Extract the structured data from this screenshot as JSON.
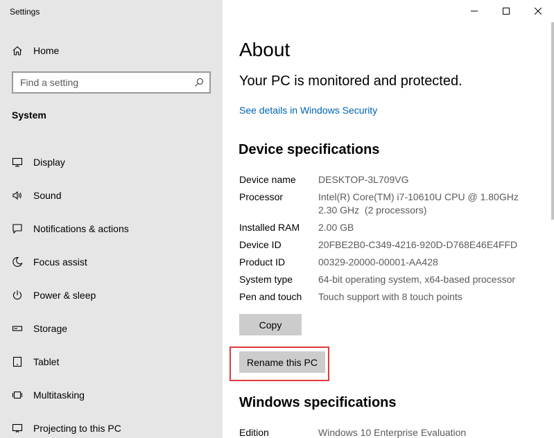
{
  "window": {
    "title": "Settings"
  },
  "sidebar": {
    "home_label": "Home",
    "search_placeholder": "Find a setting",
    "section_label": "System",
    "items": [
      {
        "label": "Display",
        "icon": "display-icon"
      },
      {
        "label": "Sound",
        "icon": "sound-icon"
      },
      {
        "label": "Notifications & actions",
        "icon": "notifications-icon"
      },
      {
        "label": "Focus assist",
        "icon": "focus-assist-icon"
      },
      {
        "label": "Power & sleep",
        "icon": "power-icon"
      },
      {
        "label": "Storage",
        "icon": "storage-icon"
      },
      {
        "label": "Tablet",
        "icon": "tablet-icon"
      },
      {
        "label": "Multitasking",
        "icon": "multitasking-icon"
      },
      {
        "label": "Projecting to this PC",
        "icon": "projecting-icon"
      }
    ]
  },
  "main": {
    "title": "About",
    "protection_text": "Your PC is monitored and protected.",
    "security_link": "See details in Windows Security",
    "device_specs_heading": "Device specifications",
    "device_specs": [
      {
        "label": "Device name",
        "value": "DESKTOP-3L709VG"
      },
      {
        "label": "Processor",
        "value": "Intel(R) Core(TM) i7-10610U CPU @ 1.80GHz   2.30 GHz  (2 processors)"
      },
      {
        "label": "Installed RAM",
        "value": "2.00 GB"
      },
      {
        "label": "Device ID",
        "value": "20FBE2B0-C349-4216-920D-D768E46E4FFD"
      },
      {
        "label": "Product ID",
        "value": "00329-20000-00001-AA428"
      },
      {
        "label": "System type",
        "value": "64-bit operating system, x64-based processor"
      },
      {
        "label": "Pen and touch",
        "value": "Touch support with 8 touch points"
      }
    ],
    "copy_button": "Copy",
    "rename_button": "Rename this PC",
    "windows_specs_heading": "Windows specifications",
    "windows_specs": [
      {
        "label": "Edition",
        "value": "Windows 10 Enterprise Evaluation"
      }
    ]
  },
  "colors": {
    "sidebar_bg": "#e6e6e6",
    "link": "#0063b1",
    "highlight": "#e03a3a",
    "button_bg": "#cccccc"
  }
}
